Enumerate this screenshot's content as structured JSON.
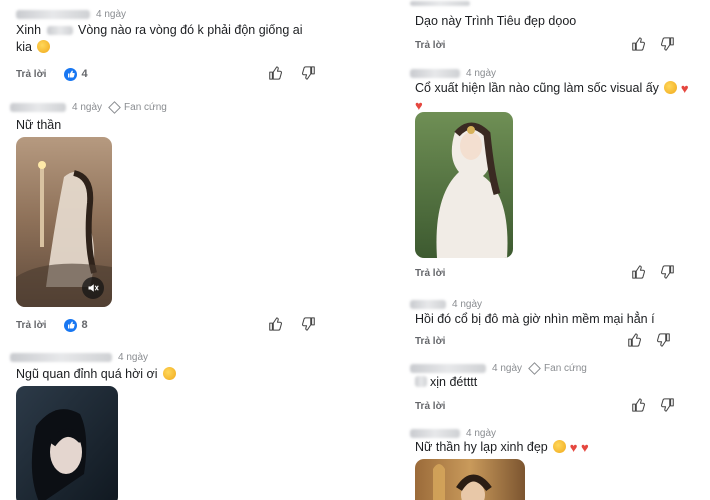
{
  "labels": {
    "reply": "Trả lời",
    "fan_badge": "Fan cứng"
  },
  "icons": {
    "like": "thumbs-up-icon",
    "dislike": "thumbs-down-icon",
    "mute": "speaker-mute-icon",
    "fan_badge": "diamond-icon"
  },
  "colors": {
    "like_badge": "#1877f2",
    "meta_text": "#8a8d91",
    "heart": "#e5473f"
  },
  "left": {
    "c1": {
      "name_prefix": "Xinh",
      "time": "4 ngày",
      "text": "Vòng nào ra vòng đó k phải độn giống ai kia",
      "likes": "4"
    },
    "c2": {
      "time": "4 ngày",
      "badge": "Fan cứng",
      "text": "Nữ thần",
      "likes": "8"
    },
    "c3": {
      "time": "4 ngày",
      "text": "Ngũ quan đỉnh quá hời ơi"
    }
  },
  "right": {
    "c1": {
      "text": "Dạo này Trình Tiêu đẹp dọoo"
    },
    "c2": {
      "time": "4 ngày",
      "text": "Cổ xuất hiện lần nào cũng làm sốc visual ấy"
    },
    "c3": {
      "time": "4 ngày",
      "text": "Hồi đó cổ bị đô mà giờ nhìn mềm mại hẳn í"
    },
    "c4": {
      "time": "4 ngày",
      "badge": "Fan cứng",
      "text": "xịn đétttt"
    },
    "c5": {
      "time": "4 ngày",
      "text": "Nữ thần hy lạp xinh đẹp"
    }
  }
}
